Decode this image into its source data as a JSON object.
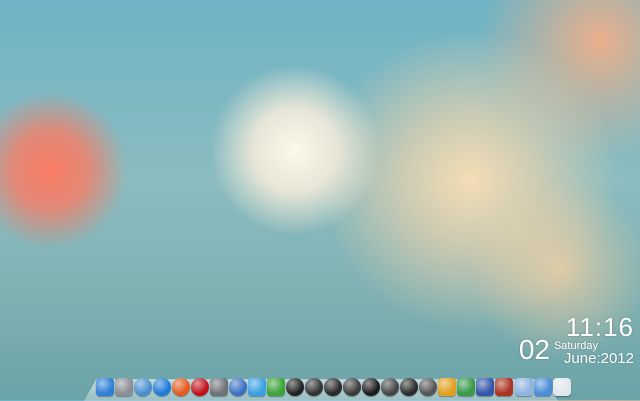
{
  "clock": {
    "time": "11:16",
    "day_number": "02",
    "weekday": "Saturday",
    "date": "June:2012"
  },
  "dock": {
    "items": [
      {
        "name": "finder-icon",
        "color": "#2f7fd6",
        "shape": "square"
      },
      {
        "name": "dashboard-icon",
        "color": "#8a8f96",
        "shape": "square"
      },
      {
        "name": "system-preferences-icon",
        "color": "#4a8fd0",
        "shape": "round"
      },
      {
        "name": "safari-icon",
        "color": "#1e79d8",
        "shape": "round"
      },
      {
        "name": "firefox-icon",
        "color": "#e35b1d",
        "shape": "round"
      },
      {
        "name": "opera-icon",
        "color": "#c1121c",
        "shape": "round"
      },
      {
        "name": "robot-icon",
        "color": "#6d7378",
        "shape": "square"
      },
      {
        "name": "itunes-icon",
        "color": "#3a6fc4",
        "shape": "round"
      },
      {
        "name": "twitter-icon",
        "color": "#3aa0e0",
        "shape": "square"
      },
      {
        "name": "utorrent-icon",
        "color": "#3da33a",
        "shape": "square"
      },
      {
        "name": "game-icon",
        "color": "#222",
        "shape": "round"
      },
      {
        "name": "game-icon",
        "color": "#333",
        "shape": "round"
      },
      {
        "name": "game-icon",
        "color": "#2a2a2a",
        "shape": "round"
      },
      {
        "name": "game-icon",
        "color": "#3b3b3b",
        "shape": "round"
      },
      {
        "name": "game-icon",
        "color": "#1c1c1c",
        "shape": "round"
      },
      {
        "name": "game-icon",
        "color": "#444",
        "shape": "round"
      },
      {
        "name": "game-icon",
        "color": "#2b2b2b",
        "shape": "round"
      },
      {
        "name": "game-icon",
        "color": "#555",
        "shape": "round"
      },
      {
        "name": "game-icon",
        "color": "#e0a020",
        "shape": "square"
      },
      {
        "name": "sims-icon",
        "color": "#3a9a4a",
        "shape": "square"
      },
      {
        "name": "game-icon",
        "color": "#3355aa",
        "shape": "square"
      },
      {
        "name": "game-icon",
        "color": "#aa3322",
        "shape": "square"
      },
      {
        "name": "folder-icon",
        "color": "#8fb4e0",
        "shape": "square"
      },
      {
        "name": "folder-icon",
        "color": "#4c8ed8",
        "shape": "square"
      },
      {
        "name": "trash-icon",
        "color": "#dfe6ec",
        "shape": "square"
      }
    ]
  }
}
